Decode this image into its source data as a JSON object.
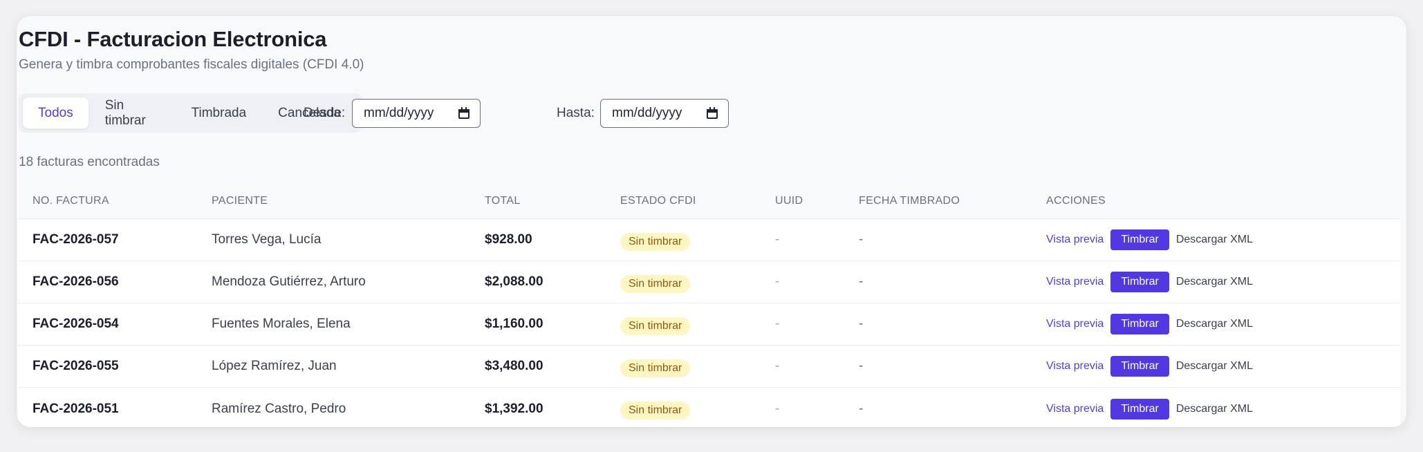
{
  "header": {
    "title": "CFDI - Facturacion Electronica",
    "subtitle": "Genera y timbra comprobantes fiscales digitales (CFDI 4.0)"
  },
  "filters": {
    "tabs": [
      "Todos",
      "Sin timbrar",
      "Timbrada",
      "Cancelada"
    ],
    "active_tab": "Todos",
    "desde_label": "Desde:",
    "hasta_label": "Hasta:",
    "desde_placeholder": "mm/dd/yyyy",
    "hasta_placeholder": "mm/dd/yyyy"
  },
  "results_count": "18 facturas encontradas",
  "table": {
    "columns": [
      "NO. FACTURA",
      "PACIENTE",
      "TOTAL",
      "ESTADO CFDI",
      "UUID",
      "FECHA TIMBRADO",
      "ACCIONES"
    ],
    "rows": [
      {
        "factura": "FAC-2026-057",
        "paciente": "Torres Vega, Lucía",
        "total": "$928.00",
        "estado": "Sin timbrar",
        "uuid": "-",
        "fecha": "-"
      },
      {
        "factura": "FAC-2026-056",
        "paciente": "Mendoza Gutiérrez, Arturo",
        "total": "$2,088.00",
        "estado": "Sin timbrar",
        "uuid": "-",
        "fecha": "-"
      },
      {
        "factura": "FAC-2026-054",
        "paciente": "Fuentes Morales, Elena",
        "total": "$1,160.00",
        "estado": "Sin timbrar",
        "uuid": "-",
        "fecha": "-"
      },
      {
        "factura": "FAC-2026-055",
        "paciente": "López Ramírez, Juan",
        "total": "$3,480.00",
        "estado": "Sin timbrar",
        "uuid": "-",
        "fecha": "-"
      },
      {
        "factura": "FAC-2026-051",
        "paciente": "Ramírez Castro, Pedro",
        "total": "$1,392.00",
        "estado": "Sin timbrar",
        "uuid": "-",
        "fecha": "-"
      }
    ],
    "actions": {
      "preview": "Vista previa",
      "stamp": "Timbrar",
      "download": "Descargar XML"
    }
  },
  "colors": {
    "accent": "#5138e0",
    "badge_bg": "#fdf6c3",
    "badge_text": "#8a5a10"
  },
  "icons": {
    "date_picker": "calendar-icon"
  }
}
